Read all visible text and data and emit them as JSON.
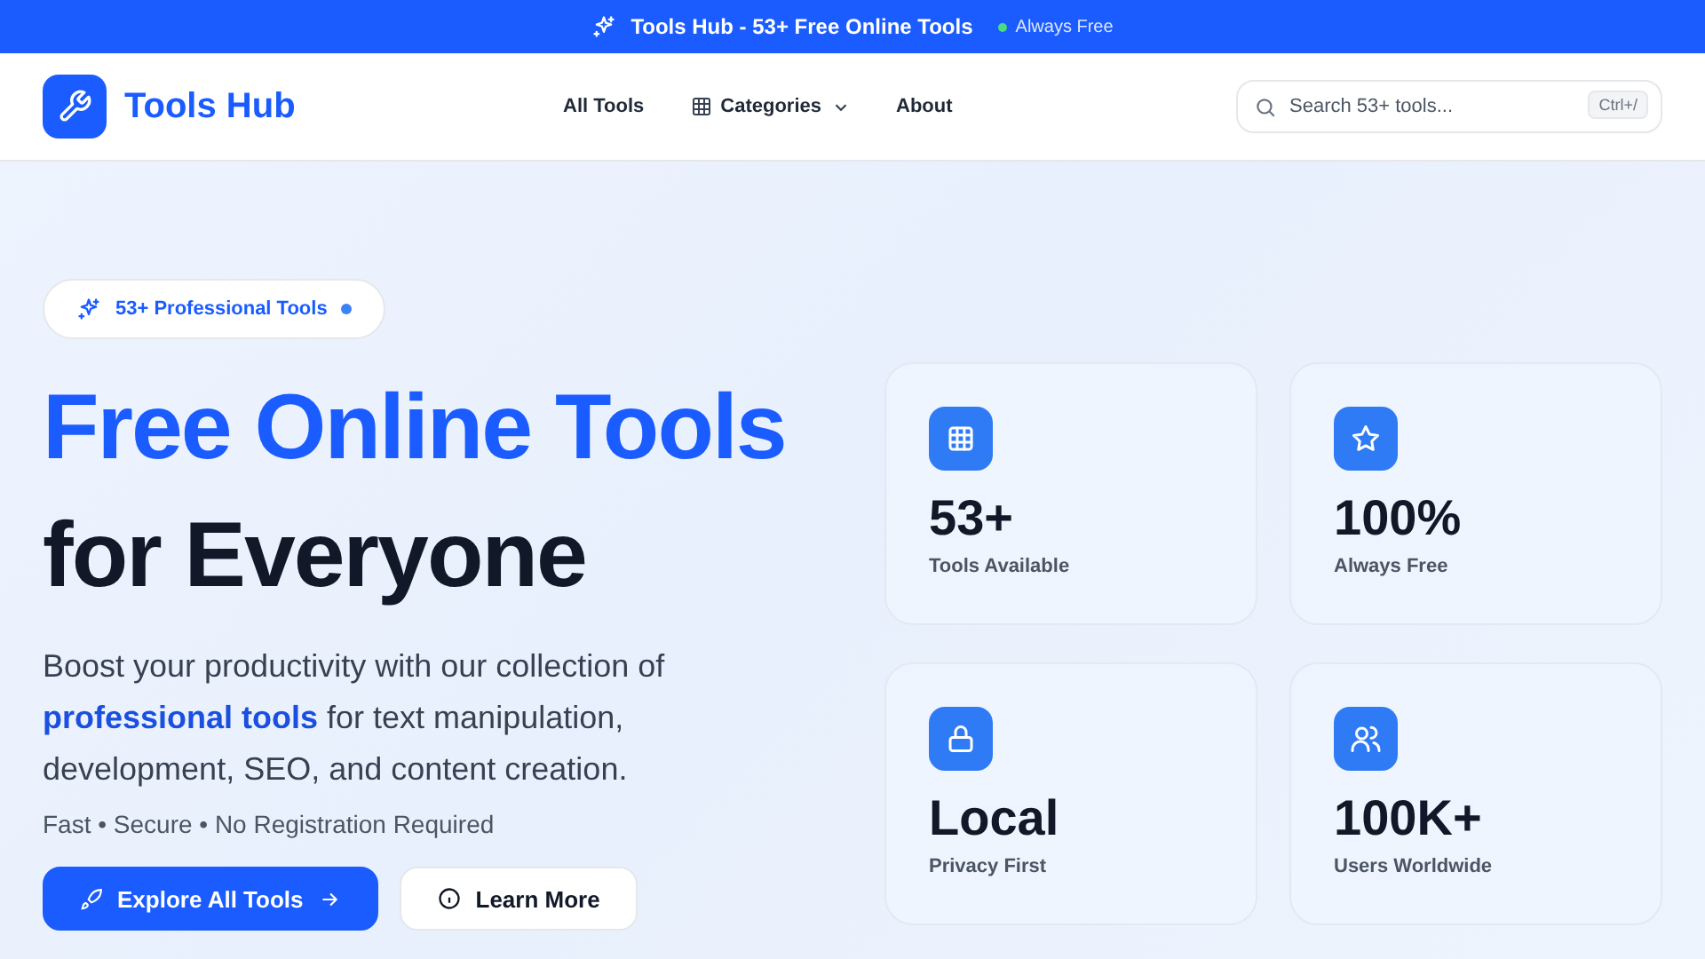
{
  "top_banner": {
    "title": "Tools Hub - 53+ Free Online Tools",
    "status": "Always Free"
  },
  "nav": {
    "brand": "Tools Hub",
    "links": [
      {
        "label": "All Tools",
        "kind": "link"
      },
      {
        "label": "Categories",
        "kind": "dropdown"
      },
      {
        "label": "About",
        "kind": "link"
      }
    ],
    "search": {
      "placeholder": "Search 53+ tools...",
      "shortcut": "Ctrl+/"
    }
  },
  "hero": {
    "badge": "53+ Professional Tools",
    "heading_line1": "Free Online Tools",
    "heading_line2": "for Everyone",
    "lead": "Boost your productivity with our collection of **professional tools** for text manipulation, development, SEO, and content creation.",
    "tagline": "Fast • Secure • No Registration Required",
    "buttons": [
      {
        "label": "Explore All Tools",
        "kind": "primary"
      },
      {
        "label": "Learn More",
        "kind": "secondary"
      }
    ]
  },
  "stats": [
    {
      "value": "53+",
      "label": "Tools Available"
    },
    {
      "value": "100%",
      "label": "Always Free"
    },
    {
      "value": "Local",
      "label": "Privacy First"
    },
    {
      "value": "100K+",
      "label": "Users Worldwide"
    }
  ]
}
